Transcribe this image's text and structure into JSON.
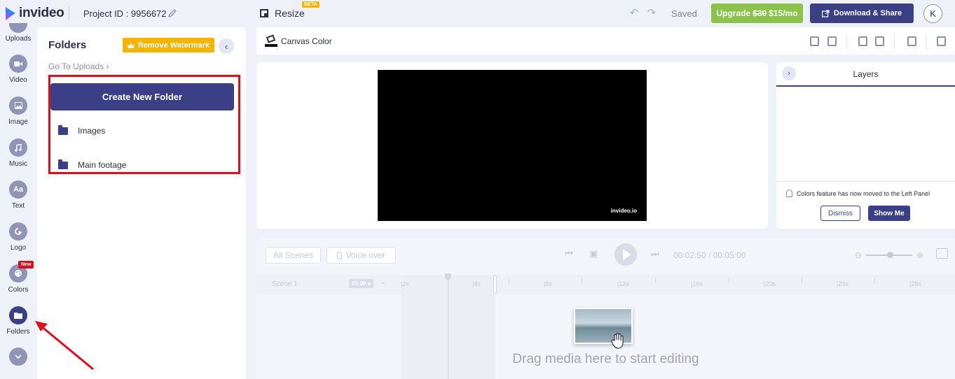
{
  "header": {
    "brand": "invideo",
    "project_id": "Project ID : 9956672",
    "resize_label": "Resize",
    "resize_badge": "BETA",
    "save_status": "Saved",
    "upgrade": {
      "prefix": "Upgrade",
      "old_price": "$30",
      "new_price": "$15/mo"
    },
    "download_label": "Download & Share",
    "avatar_initial": "K"
  },
  "rail": {
    "items": [
      {
        "label": "Uploads",
        "icon": "upload-icon"
      },
      {
        "label": "Video",
        "icon": "video-icon"
      },
      {
        "label": "Image",
        "icon": "image-icon"
      },
      {
        "label": "Music",
        "icon": "music-icon"
      },
      {
        "label": "Text",
        "icon": "text-icon",
        "glyph": "Aa"
      },
      {
        "label": "Logo",
        "icon": "logo-icon"
      },
      {
        "label": "Colors",
        "icon": "palette-icon",
        "badge": "New"
      },
      {
        "label": "Folders",
        "icon": "folder-icon",
        "active": true
      }
    ]
  },
  "folders_panel": {
    "title": "Folders",
    "watermark_button": "Remove Watermark",
    "goto_uploads": "Go To Uploads",
    "create_button": "Create New Folder",
    "folders": [
      {
        "name": "Images"
      },
      {
        "name": "Main footage"
      }
    ]
  },
  "canvas_toolbar": {
    "canvas_color_label": "Canvas Color"
  },
  "stage": {
    "watermark": "invideo.io"
  },
  "layers": {
    "title": "Layers",
    "notice": "Colors feature has now moved to the Left Panel",
    "dismiss_label": "Dismiss",
    "show_me_label": "Show Me"
  },
  "timeline": {
    "all_scenes": "All Scenes",
    "voice_over": "Voice over",
    "current_time": "00:02:50",
    "separator": "/",
    "total_time": "00:05:00",
    "scene_label": "Scene 1",
    "scene_duration": "05:00 s",
    "ticks": [
      "|2s",
      "|4s",
      "|8s",
      "|12s",
      "|16s",
      "|20s",
      "|24s",
      "|28s"
    ],
    "drop_hint": "Drag media here to start editing"
  },
  "colors": {
    "primary": "#3b3f86",
    "upgrade": "#8bc34a",
    "watermark": "#f5b400",
    "annotation": "#e10d1b"
  }
}
